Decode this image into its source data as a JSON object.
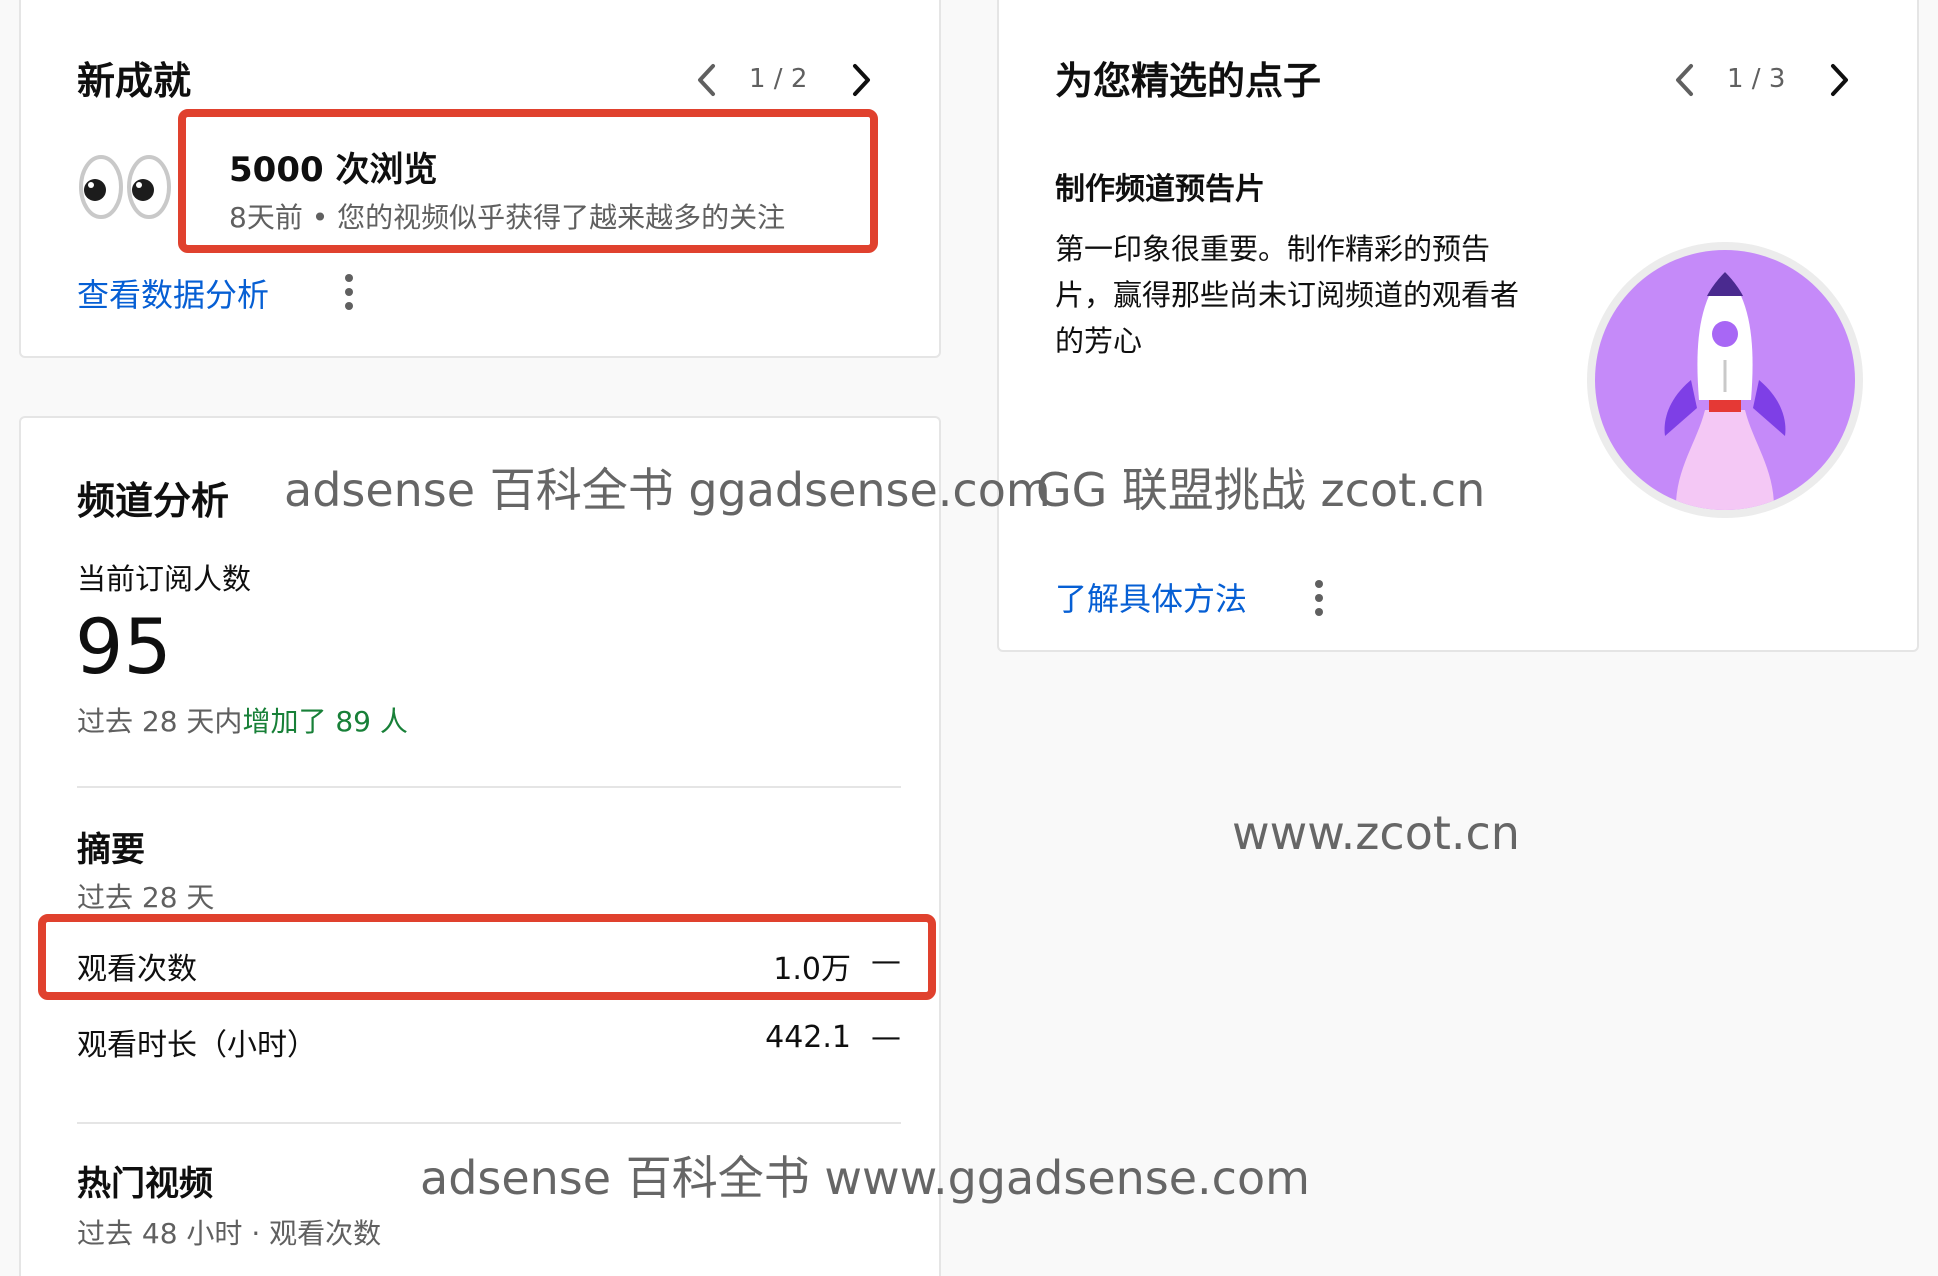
{
  "achievements": {
    "title": "新成就",
    "pager": "1 / 2",
    "item_title": "5000 次浏览",
    "item_meta": "8天前 • 您的视频似乎获得了越来越多的关注",
    "link": "查看数据分析",
    "icon": "eyes-emoji-icon"
  },
  "ideas": {
    "title": "为您精选的点子",
    "pager": "1 / 3",
    "subtitle": "制作频道预告片",
    "body_lines": [
      "第一印象很重要。制作精彩的预告",
      "片，赢得那些尚未订阅频道的观看者",
      "的芳心"
    ],
    "link": "了解具体方法",
    "icon": "rocket-icon",
    "colors": {
      "circle": "#c58af9",
      "rocket_body": "#ffffff",
      "flame": "#f4c8f5",
      "fins": "#7e3fe6",
      "nozzle": "#e53935"
    }
  },
  "analytics": {
    "title": "频道分析",
    "subscribers_label": "当前订阅人数",
    "subscribers_value": "95",
    "change_prefix": "过去 28 天内",
    "change_value": "增加了 89 人",
    "summary_title": "摘要",
    "summary_period": "过去 28 天",
    "rows": [
      {
        "label": "观看次数",
        "value": "1.0万",
        "trend": "—"
      },
      {
        "label": "观看时长（小时）",
        "value": "442.1",
        "trend": "—"
      }
    ],
    "top_videos_title": "热门视频",
    "top_videos_meta": "过去 48 小时 · 观看次数"
  },
  "watermarks": [
    "adsense 百科全书 ggadsense.com",
    "GG 联盟挑战 zcot.cn",
    "www.zcot.cn",
    "adsense 百科全书 www.ggadsense.com"
  ],
  "colors": {
    "accent": "#065fd4",
    "positive": "#188038",
    "highlight": "#e0412e"
  }
}
